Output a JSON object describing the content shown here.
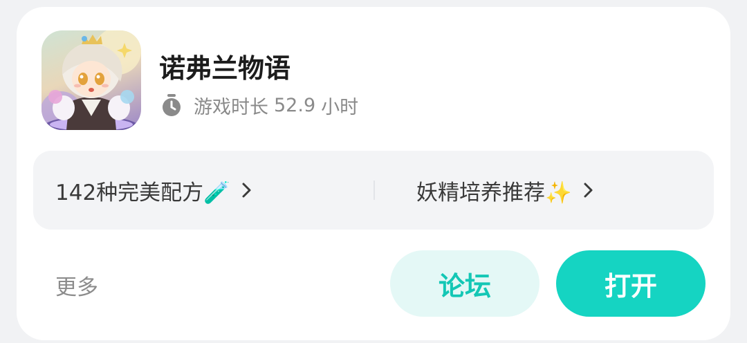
{
  "game": {
    "title": "诺弗兰物语",
    "icon": "game-cover-art-icon",
    "playtime_label": "游戏时长",
    "playtime_value": "52.9",
    "playtime_unit": "小时",
    "playtime_icon": "stopwatch-icon"
  },
  "links": [
    {
      "label": "142种完美配方🧪",
      "icon": "chevron-right-icon"
    },
    {
      "label": "妖精培养推荐✨",
      "icon": "chevron-right-icon"
    }
  ],
  "footer": {
    "more_label": "更多",
    "forum_label": "论坛",
    "open_label": "打开"
  },
  "colors": {
    "accent": "#15d4c2",
    "accent_text": "#13c7b5",
    "accent_light_bg": "#e4f8f6",
    "panel_bg": "#f3f4f6",
    "card_bg": "#ffffff",
    "page_bg": "#f1f2f4",
    "muted_text": "#8a8a8a"
  }
}
